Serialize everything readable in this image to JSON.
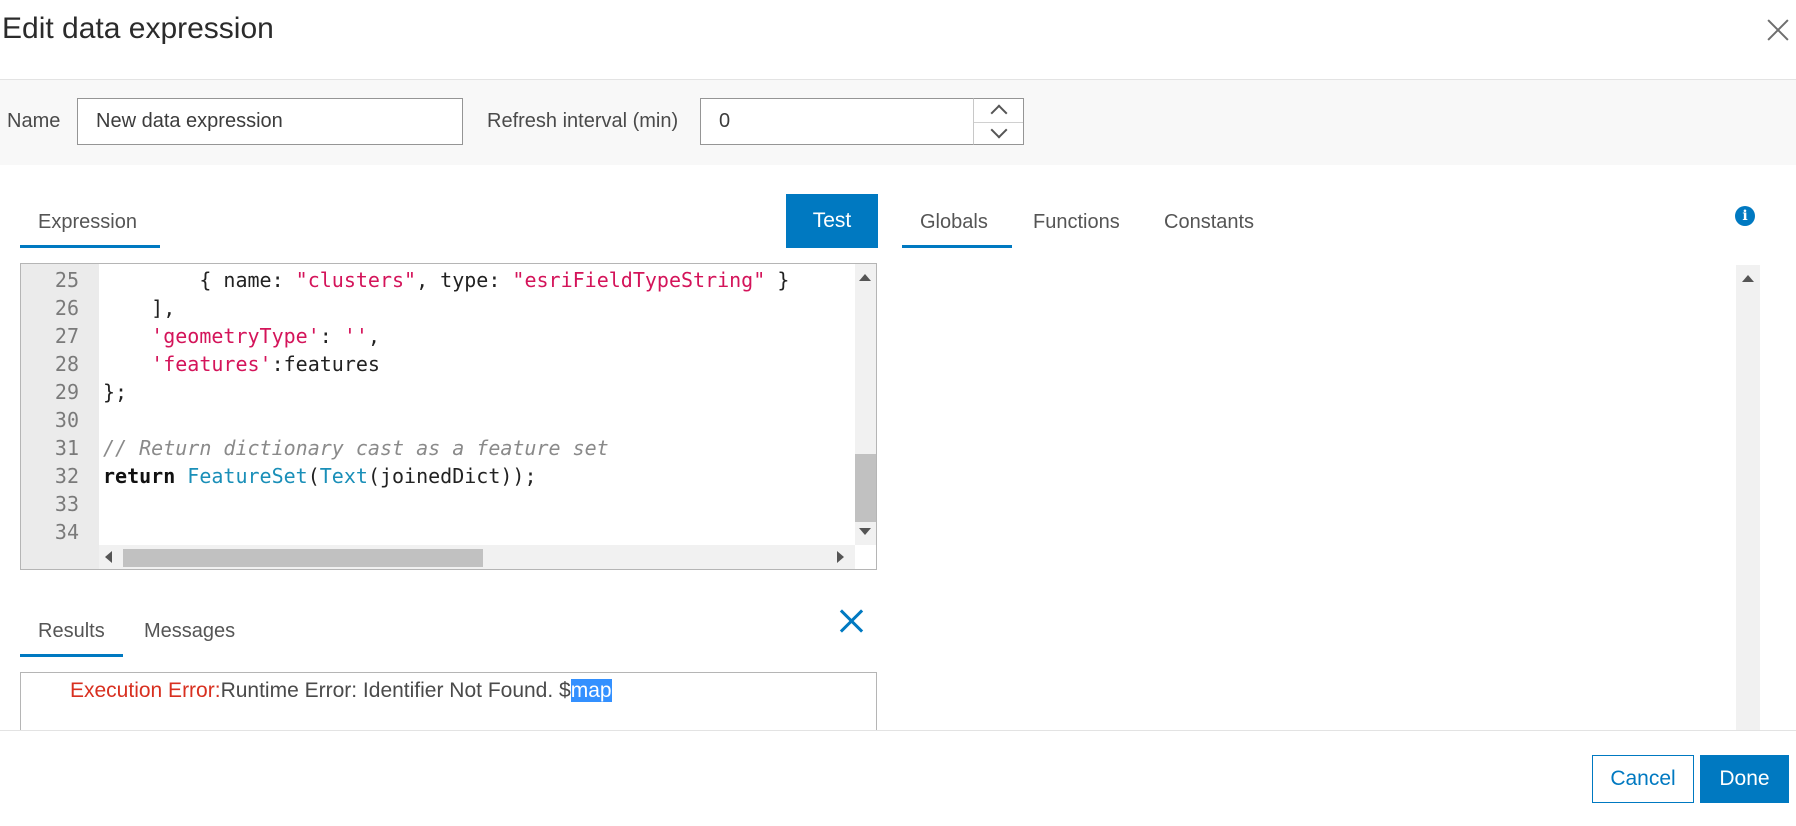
{
  "dialog": {
    "title": "Edit data expression"
  },
  "form": {
    "name_label": "Name",
    "name_value": "New data expression",
    "refresh_label": "Refresh interval (min)",
    "refresh_value": "0"
  },
  "left_tabs": {
    "expression": "Expression",
    "test_button": "Test"
  },
  "right_tabs": {
    "globals": "Globals",
    "functions": "Functions",
    "constants": "Constants"
  },
  "editor": {
    "line_numbers": [
      "25",
      "26",
      "27",
      "28",
      "29",
      "30",
      "31",
      "32",
      "33",
      "34"
    ],
    "lines": [
      [
        {
          "t": "        { name: ",
          "c": ""
        },
        {
          "t": "\"clusters\"",
          "c": "str"
        },
        {
          "t": ", type: ",
          "c": ""
        },
        {
          "t": "\"esriFieldTypeString\"",
          "c": "str"
        },
        {
          "t": " }",
          "c": ""
        }
      ],
      [
        {
          "t": "    ],",
          "c": ""
        }
      ],
      [
        {
          "t": "    ",
          "c": ""
        },
        {
          "t": "'geometryType'",
          "c": "str"
        },
        {
          "t": ": ",
          "c": ""
        },
        {
          "t": "''",
          "c": "str"
        },
        {
          "t": ",",
          "c": ""
        }
      ],
      [
        {
          "t": "    ",
          "c": ""
        },
        {
          "t": "'features'",
          "c": "str"
        },
        {
          "t": ":features",
          "c": ""
        }
      ],
      [
        {
          "t": "};",
          "c": ""
        }
      ],
      [
        {
          "t": "",
          "c": ""
        }
      ],
      [
        {
          "t": "// Return dictionary cast as a feature set",
          "c": "cmt"
        }
      ],
      [
        {
          "t": "return",
          "c": "kw"
        },
        {
          "t": " ",
          "c": ""
        },
        {
          "t": "FeatureSet",
          "c": "fn"
        },
        {
          "t": "(",
          "c": ""
        },
        {
          "t": "Text",
          "c": "fn"
        },
        {
          "t": "(joinedDict));",
          "c": ""
        }
      ],
      [
        {
          "t": "",
          "c": ""
        }
      ],
      [
        {
          "t": "",
          "c": ""
        }
      ]
    ]
  },
  "results": {
    "tabs": {
      "results": "Results",
      "messages": "Messages"
    },
    "error_label": "Execution Error:",
    "error_text": "Runtime Error: Identifier Not Found. $",
    "error_highlight": "map"
  },
  "footer": {
    "cancel": "Cancel",
    "done": "Done"
  },
  "colors": {
    "accent": "#0079c1",
    "error": "#d83020",
    "string": "#d4145a",
    "function": "#1a8fb8"
  }
}
